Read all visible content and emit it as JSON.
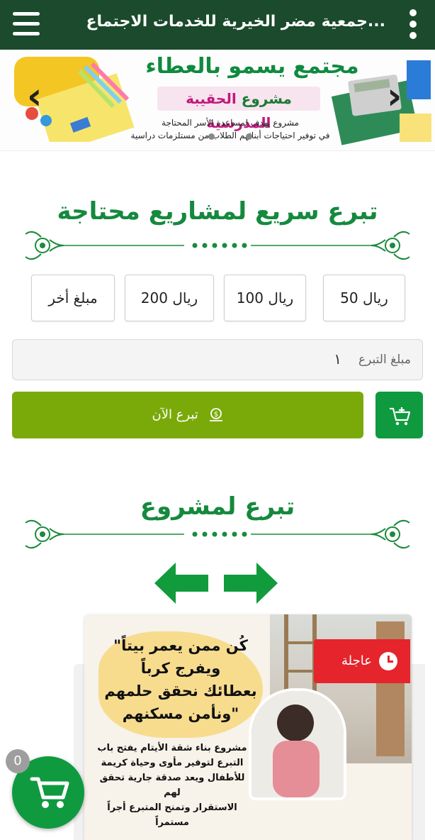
{
  "header": {
    "title": "جمعية مضر الخيرية للخدمات الاجتماعية",
    "title_display": "جمعية مضر الخيرية للخدمات الاجتماع..."
  },
  "banner": {
    "title": "مجتمع يسمو بالعطاء",
    "subtitle_green": "مشروع ",
    "subtitle_pink": "الحقيبة المدرسية",
    "desc_line1": "مشروع يهدف لمساعدة الأسر المحتاجة",
    "desc_line2": "في توفير احتياجات أبنائهم الطلاب من مستلزمات دراسية",
    "prev": "‹",
    "next": "›"
  },
  "quick_donate": {
    "heading": "تبرع سريع لمشاريع محتاجة",
    "amounts": [
      "50 ريال",
      "100 ريال",
      "200 ريال",
      "مبلغ أخر"
    ],
    "input_label": "مبلغ التبرع",
    "input_value": "١",
    "donate_label": "تبرع الآن"
  },
  "project_section": {
    "heading": "تبرع لمشروع"
  },
  "project_card": {
    "badge": "عاجلة",
    "quote_l1": "\"كُن ممن يعمر بيتاً",
    "quote_l2": "ويفرج كرباً",
    "quote_l3": "بعطائك نحقق حلمهم",
    "quote_l4": "ونأمن مسكنهم\"",
    "desc_l1": "مشروع بناء شقة الأيتام يفتح باب",
    "desc_l2": "التبرع لتوفير مأوى وحياة كريمة",
    "desc_l3": "للأطفال ويعد صدقة جارية تحقق لهم",
    "desc_l4": "الاستقرار وتمنح المتبرع أجراً مستمراً"
  },
  "cart": {
    "count": "0"
  },
  "colors": {
    "header_bg": "#1b4a2c",
    "accent_green": "#15893e",
    "donate_button": "#7aaa0a",
    "cart_green": "#0f9a3f",
    "urgent_red": "#e5242c"
  }
}
